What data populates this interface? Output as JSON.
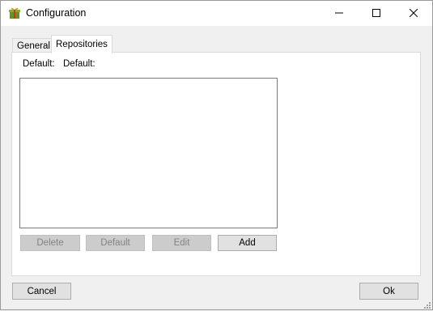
{
  "window": {
    "title": "Configuration",
    "icon": "gift-box-icon",
    "controls": {
      "minimize": "minimize-icon",
      "maximize": "maximize-icon",
      "close": "close-icon"
    }
  },
  "tabs": [
    {
      "label": "General",
      "selected": false
    },
    {
      "label": "Repositories",
      "selected": true
    }
  ],
  "repositories": {
    "default_label_1": "Default:",
    "default_label_2": "Default:",
    "list_items": [],
    "buttons": {
      "delete": "Delete",
      "default": "Default",
      "edit": "Edit",
      "add": "Add"
    }
  },
  "footer": {
    "cancel": "Cancel",
    "ok": "Ok"
  }
}
